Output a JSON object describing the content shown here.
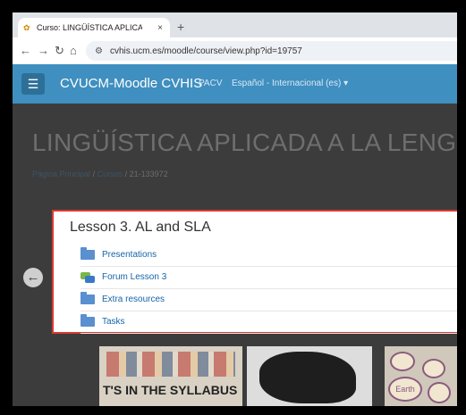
{
  "browser": {
    "tab_title": "Curso: LINGÜÍSTICA APLICA",
    "tab_close": "×",
    "new_tab": "+",
    "url": "cvhis.ucm.es/moodle/course/view.php?id=19757"
  },
  "navbar": {
    "brand": "CVUCM-Moodle CVHIS",
    "pacv": "PACV",
    "language": "Español - Internacional (es) ▾"
  },
  "course": {
    "title": "LINGÜÍSTICA APLICADA A LA LENGUA INGI",
    "breadcrumb": {
      "home": "Página Principal",
      "sep1": "/",
      "courses": "Cursos",
      "sep2": "/",
      "course_id": "21-133972"
    }
  },
  "modal": {
    "title": "Lesson 3. AL and SLA",
    "items": [
      {
        "label": "Presentations",
        "icon": "folder-icon"
      },
      {
        "label": "Forum Lesson 3",
        "icon": "forum-icon"
      },
      {
        "label": "Extra resources",
        "icon": "folder-icon"
      },
      {
        "label": "Tasks",
        "icon": "folder-icon"
      }
    ]
  },
  "thumbnails": {
    "syllabus_caption": "T'S IN THE SYLLABUS",
    "bubble_word": "Earth"
  },
  "colors": {
    "navbar": "#3f8fc0",
    "modal_border": "#d9392f",
    "link": "#1565a8"
  }
}
